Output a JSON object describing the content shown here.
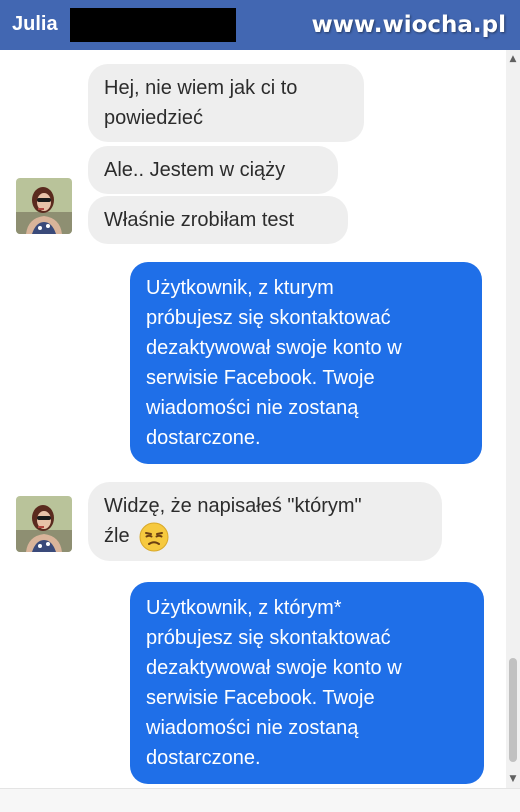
{
  "header": {
    "contact_name": "Julia",
    "watermark": "www.wiocha.pl",
    "accent_color": "#4267b2"
  },
  "messages": [
    {
      "from": "contact",
      "lines": [
        "Hej, nie wiem jak ci to",
        "powiedzieć"
      ]
    },
    {
      "from": "contact",
      "lines": [
        "Ale.. Jestem w ciąży"
      ]
    },
    {
      "from": "contact",
      "lines": [
        "Właśnie zrobiłam test"
      ]
    },
    {
      "from": "me",
      "lines": [
        "Użytkownik, z kturym",
        "próbujesz się skontaktować",
        "dezaktywował swoje konto w",
        "serwisie Facebook. Twoje",
        "wiadomości nie zostaną",
        "dostarczone."
      ]
    },
    {
      "from": "contact",
      "lines": [
        "Widzę, że napisałeś \"którym\"",
        "źle"
      ],
      "emoji": "unamused-face"
    },
    {
      "from": "me",
      "lines": [
        "Użytkownik, z którym*",
        "próbujesz się skontaktować",
        "dezaktywował swoje konto w",
        "serwisie Facebook. Twoje",
        "wiadomości nie zostaną",
        "dostarczone."
      ]
    }
  ],
  "colors": {
    "incoming_bubble": "#eeeeee",
    "outgoing_bubble": "#1f6fe8"
  },
  "icons": {
    "scroll_up": "scroll-up-arrow-icon",
    "scroll_down": "scroll-down-arrow-icon"
  }
}
